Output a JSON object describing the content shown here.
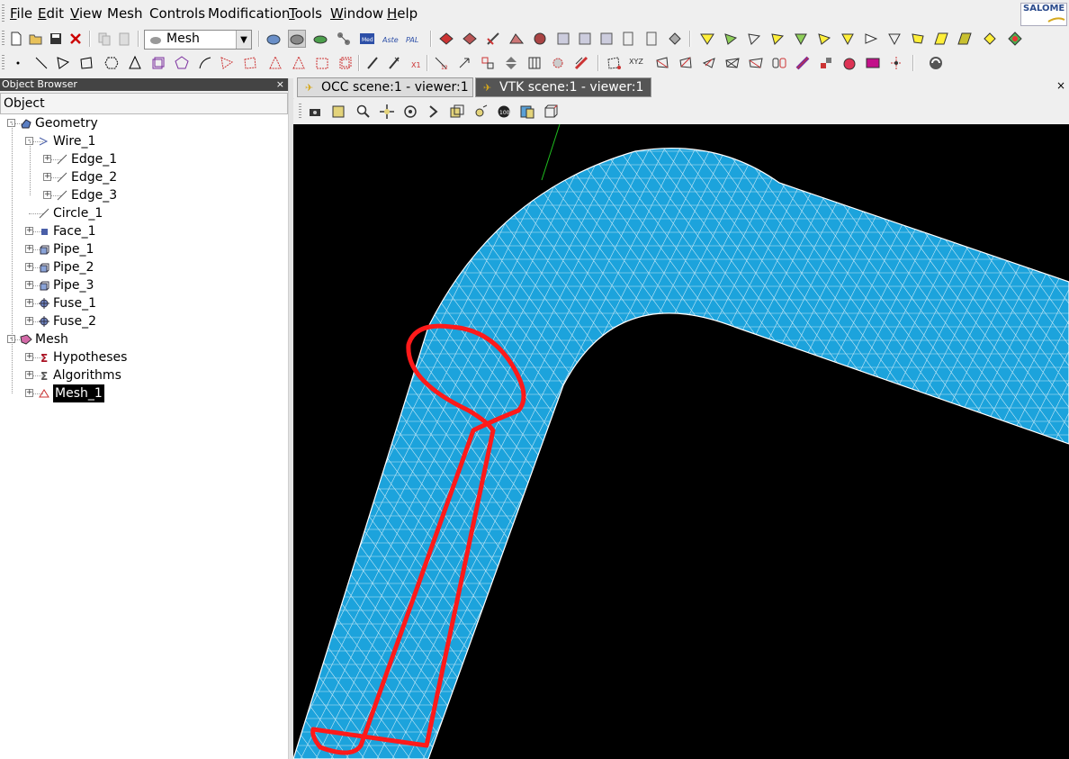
{
  "menubar": {
    "items": [
      "File",
      "Edit",
      "View",
      "Mesh",
      "Controls",
      "Modification",
      "Tools",
      "Window",
      "Help"
    ],
    "underline_first": [
      true,
      true,
      true,
      false,
      false,
      false,
      true,
      true,
      true
    ]
  },
  "logo": {
    "text": "SALOME"
  },
  "toolbar": {
    "module_combo": "Mesh"
  },
  "object_browser": {
    "title": "Object Browser",
    "close": "×",
    "column_header": "Object",
    "nodes": [
      {
        "label": "Geometry",
        "icon": "geometry-icon"
      },
      {
        "label": "Wire_1",
        "icon": "wire-icon"
      },
      {
        "label": "Edge_1",
        "icon": "edge-icon"
      },
      {
        "label": "Edge_2",
        "icon": "edge-icon"
      },
      {
        "label": "Edge_3",
        "icon": "edge-icon"
      },
      {
        "label": "Circle_1",
        "icon": "edge-icon"
      },
      {
        "label": "Face_1",
        "icon": "face-icon"
      },
      {
        "label": "Pipe_1",
        "icon": "solid-icon"
      },
      {
        "label": "Pipe_2",
        "icon": "solid-icon"
      },
      {
        "label": "Pipe_3",
        "icon": "solid-icon"
      },
      {
        "label": "Fuse_1",
        "icon": "fuse-icon"
      },
      {
        "label": "Fuse_2",
        "icon": "fuse-icon"
      },
      {
        "label": "Mesh",
        "icon": "mesh-module-icon"
      },
      {
        "label": "Hypotheses",
        "icon": "hypothesis-icon"
      },
      {
        "label": "Algorithms",
        "icon": "algorithm-icon"
      },
      {
        "label": "Mesh_1",
        "icon": "mesh-icon",
        "selected": true
      }
    ]
  },
  "viewer": {
    "tabs": [
      {
        "label": "OCC scene:1 - viewer:1",
        "active": false
      },
      {
        "label": "VTK scene:1 - viewer:1",
        "active": true
      }
    ],
    "close": "×",
    "tube_color": "#1ca3dc",
    "annotation_color": "#ff1a1a",
    "background": "#000000"
  }
}
